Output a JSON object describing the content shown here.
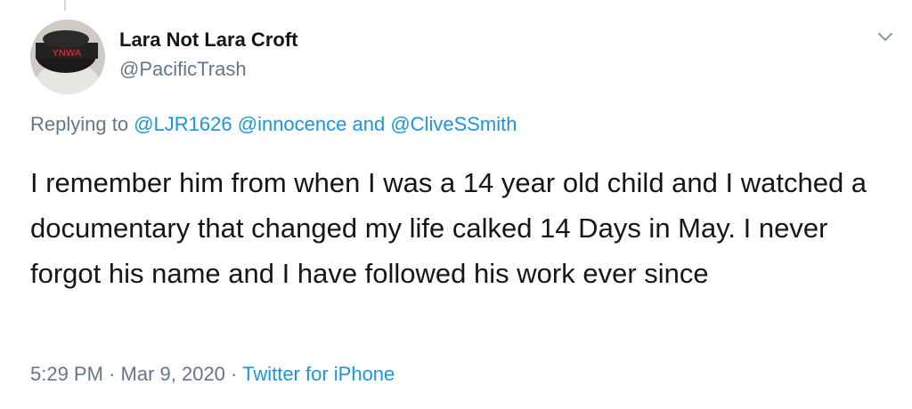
{
  "tweet": {
    "display_name": "Lara Not Lara Croft",
    "handle": "@PacificTrash",
    "avatar_text": "YNWA",
    "replying": {
      "prefix": "Replying to",
      "mention1": "@LJR1626",
      "mention2": "@innocence",
      "conjunction": "and",
      "mention3": "@CliveSSmith"
    },
    "body": "I remember him from when I was a 14 year old child and I watched a documentary that changed my life calked 14 Days in May. I never forgot his name and I have followed his work ever since",
    "time": "5:29 PM",
    "date": "Mar 9, 2020",
    "separator": "·",
    "source": "Twitter for iPhone"
  },
  "colors": {
    "link": "#1b95e0",
    "secondary_text": "#657786",
    "primary_text": "#14171a",
    "thread_line": "#ccd6dd"
  },
  "icons": {
    "menu": "chevron-down-icon"
  }
}
